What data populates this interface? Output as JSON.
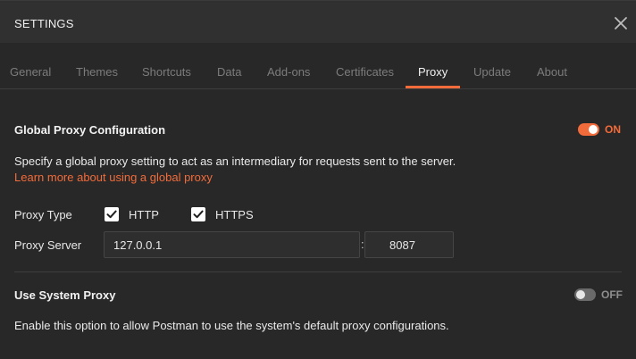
{
  "header": {
    "title": "SETTINGS"
  },
  "tabs": [
    {
      "label": "General"
    },
    {
      "label": "Themes"
    },
    {
      "label": "Shortcuts"
    },
    {
      "label": "Data"
    },
    {
      "label": "Add-ons"
    },
    {
      "label": "Certificates"
    },
    {
      "label": "Proxy",
      "active": true
    },
    {
      "label": "Update"
    },
    {
      "label": "About"
    }
  ],
  "global_proxy": {
    "title": "Global Proxy Configuration",
    "toggle_state": "ON",
    "description": "Specify a global proxy setting to act as an intermediary for requests sent to the server.",
    "learn_more": "Learn more about using a global proxy",
    "proxy_type_label": "Proxy Type",
    "http_label": "HTTP",
    "http_checked": true,
    "https_label": "HTTPS",
    "https_checked": true,
    "proxy_server_label": "Proxy Server",
    "host": "127.0.0.1",
    "port": "8087",
    "separator": ":"
  },
  "system_proxy": {
    "title": "Use System Proxy",
    "toggle_state": "OFF",
    "description": "Enable this option to allow Postman to use the system's default proxy configurations."
  },
  "colors": {
    "accent": "#f26b3a",
    "background": "#282828",
    "header_bg": "#303030",
    "tab_inactive": "#7c7c7c",
    "toggle_off": "#6a6a6a"
  },
  "icons": {
    "close": "close-icon",
    "checkbox_check": "checkmark-icon"
  }
}
